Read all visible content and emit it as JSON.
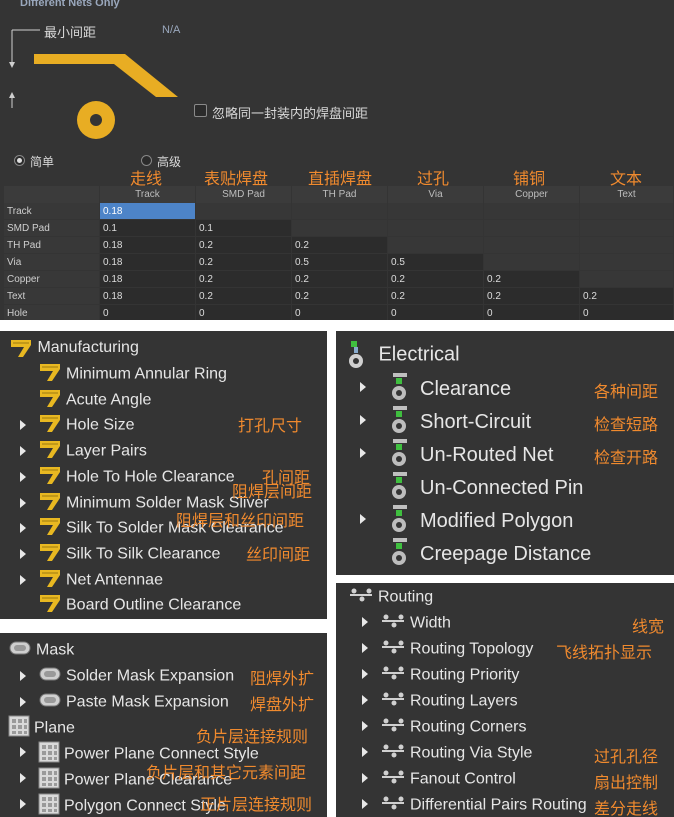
{
  "top": {
    "section_title": "Different Nets Only",
    "min_clearance_label": "最小间距",
    "na_value": "N/A",
    "ignore_checkbox_label": "忽略同一封装内的焊盘间距",
    "radio_simple": "简单",
    "radio_advanced": "高级",
    "annotations": [
      "走线",
      "表贴焊盘",
      "直插焊盘",
      "过孔",
      "铺铜",
      "文本"
    ],
    "columns": [
      "Track",
      "SMD Pad",
      "TH Pad",
      "Via",
      "Copper",
      "Text"
    ],
    "rows": [
      {
        "label": "Track",
        "values": [
          "0.18",
          "",
          "",
          "",
          "",
          ""
        ]
      },
      {
        "label": "SMD Pad",
        "values": [
          "0.1",
          "0.1",
          "",
          "",
          "",
          ""
        ]
      },
      {
        "label": "TH Pad",
        "values": [
          "0.18",
          "0.2",
          "0.2",
          "",
          "",
          ""
        ]
      },
      {
        "label": "Via",
        "values": [
          "0.18",
          "0.2",
          "0.5",
          "0.5",
          "",
          ""
        ]
      },
      {
        "label": "Copper",
        "values": [
          "0.18",
          "0.2",
          "0.2",
          "0.2",
          "0.2",
          ""
        ]
      },
      {
        "label": "Text",
        "values": [
          "0.18",
          "0.2",
          "0.2",
          "0.2",
          "0.2",
          "0.2"
        ]
      },
      {
        "label": "Hole",
        "values": [
          "0",
          "0",
          "0",
          "0",
          "0",
          "0"
        ]
      }
    ],
    "accent_color": "#e8ad23",
    "selection_color": "#4d84c8",
    "annotation_color": "#f08a2e"
  },
  "manufacturing": {
    "title": "Manufacturing",
    "icon": "manufacturing-rule-icon",
    "items": [
      {
        "label": "Minimum Annular Ring",
        "expandable": false,
        "note": ""
      },
      {
        "label": "Acute Angle",
        "expandable": false,
        "note": ""
      },
      {
        "label": "Hole Size",
        "expandable": true,
        "note": "打孔尺寸"
      },
      {
        "label": "Layer Pairs",
        "expandable": true,
        "note": ""
      },
      {
        "label": "Hole To Hole Clearance",
        "expandable": true,
        "note": "孔间距"
      },
      {
        "label": "Minimum Solder Mask Sliver",
        "expandable": true,
        "note": "阻焊层间距"
      },
      {
        "label": "Silk To Solder Mask Clearance",
        "expandable": true,
        "note": "阻焊层和丝印间距"
      },
      {
        "label": "Silk To Silk Clearance",
        "expandable": true,
        "note": "丝印间距"
      },
      {
        "label": "Net Antennae",
        "expandable": true,
        "note": ""
      },
      {
        "label": "Board Outline Clearance",
        "expandable": false,
        "note": ""
      }
    ]
  },
  "electrical": {
    "title": "Electrical",
    "icon": "electrical-rule-icon",
    "items": [
      {
        "label": "Clearance",
        "expandable": true,
        "note": "各种间距"
      },
      {
        "label": "Short-Circuit",
        "expandable": true,
        "note": "检查短路"
      },
      {
        "label": "Un-Routed Net",
        "expandable": true,
        "note": "检查开路"
      },
      {
        "label": "Un-Connected Pin",
        "expandable": false,
        "note": ""
      },
      {
        "label": "Modified Polygon",
        "expandable": true,
        "note": ""
      },
      {
        "label": "Creepage Distance",
        "expandable": false,
        "note": ""
      }
    ]
  },
  "mask_plane": {
    "mask_title": "Mask",
    "mask_items": [
      {
        "label": "Solder Mask Expansion",
        "note": "阻焊外扩"
      },
      {
        "label": "Paste Mask Expansion",
        "note": "焊盘外扩"
      }
    ],
    "plane_title": "Plane",
    "plane_items": [
      {
        "label": "Power Plane Connect Style",
        "note": "负片层连接规则"
      },
      {
        "label": "Power Plane Clearance",
        "note": "负片层和其它元素间距"
      },
      {
        "label": "Polygon Connect Style",
        "note": "正片层连接规则"
      }
    ]
  },
  "routing": {
    "title": "Routing",
    "items": [
      {
        "label": "Width",
        "note": "线宽"
      },
      {
        "label": "Routing Topology",
        "note": "飞线拓扑显示"
      },
      {
        "label": "Routing Priority",
        "note": ""
      },
      {
        "label": "Routing Layers",
        "note": ""
      },
      {
        "label": "Routing Corners",
        "note": ""
      },
      {
        "label": "Routing Via Style",
        "note": "过孔孔径"
      },
      {
        "label": "Fanout Control",
        "note": "扇出控制"
      },
      {
        "label": "Differential Pairs Routing",
        "note": "差分走线"
      }
    ]
  }
}
